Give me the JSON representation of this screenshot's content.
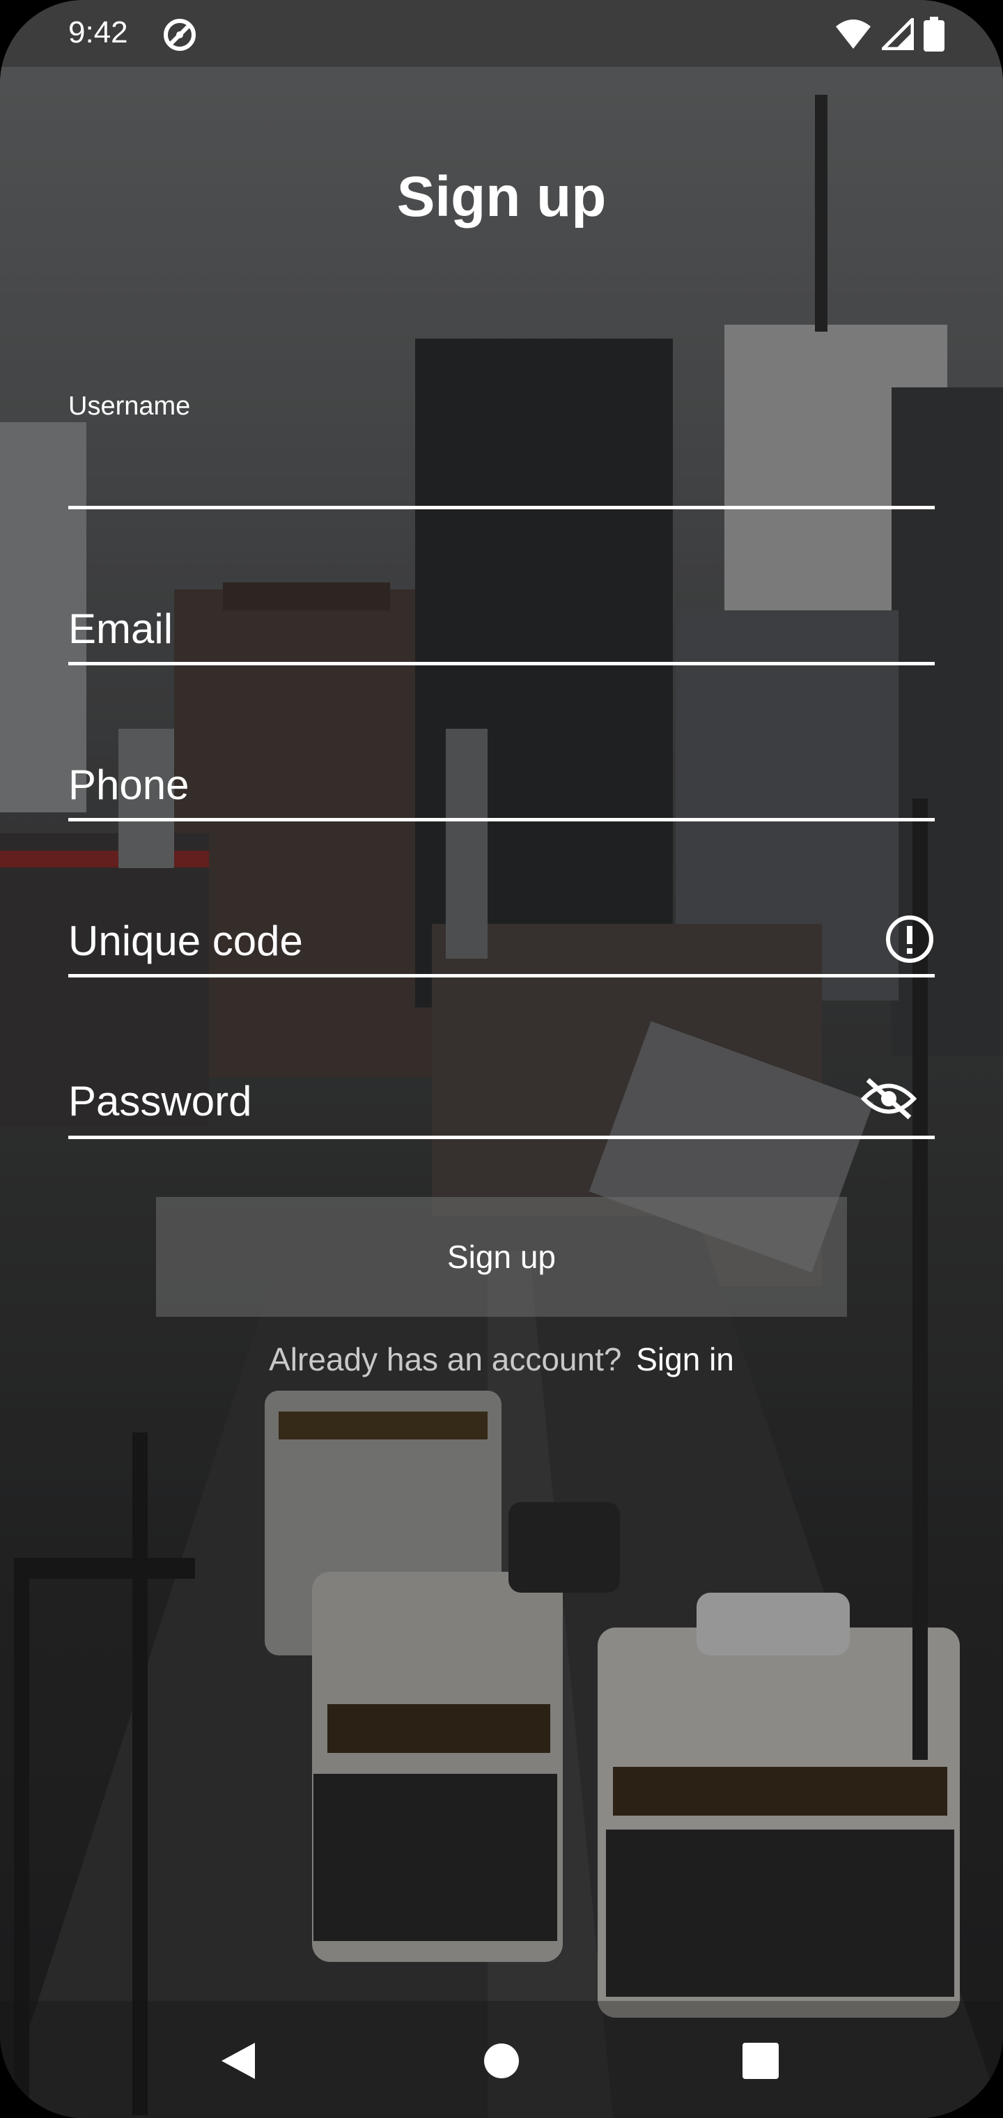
{
  "status_bar": {
    "time": "9:42",
    "icons": [
      "dnd-icon",
      "wifi-icon",
      "signal-icon",
      "battery-icon"
    ]
  },
  "screen": {
    "title": "Sign up"
  },
  "form": {
    "username": {
      "label": "Username",
      "value": ""
    },
    "email": {
      "placeholder": "Email"
    },
    "phone": {
      "placeholder": "Phone"
    },
    "unique_code": {
      "placeholder": "Unique code",
      "icon": "alert-circle-icon"
    },
    "password": {
      "placeholder": "Password",
      "icon": "eye-off-icon"
    },
    "submit_label": "Sign up"
  },
  "signin": {
    "prompt": "Already has an account?",
    "link": "Sign in"
  },
  "nav_bar": {
    "icons": [
      "back-icon",
      "home-icon",
      "recents-icon"
    ]
  },
  "colors": {
    "text": "#ffffff",
    "status_bar_bg": "#3d3d3d",
    "button_bg": "#6e6e6e"
  }
}
